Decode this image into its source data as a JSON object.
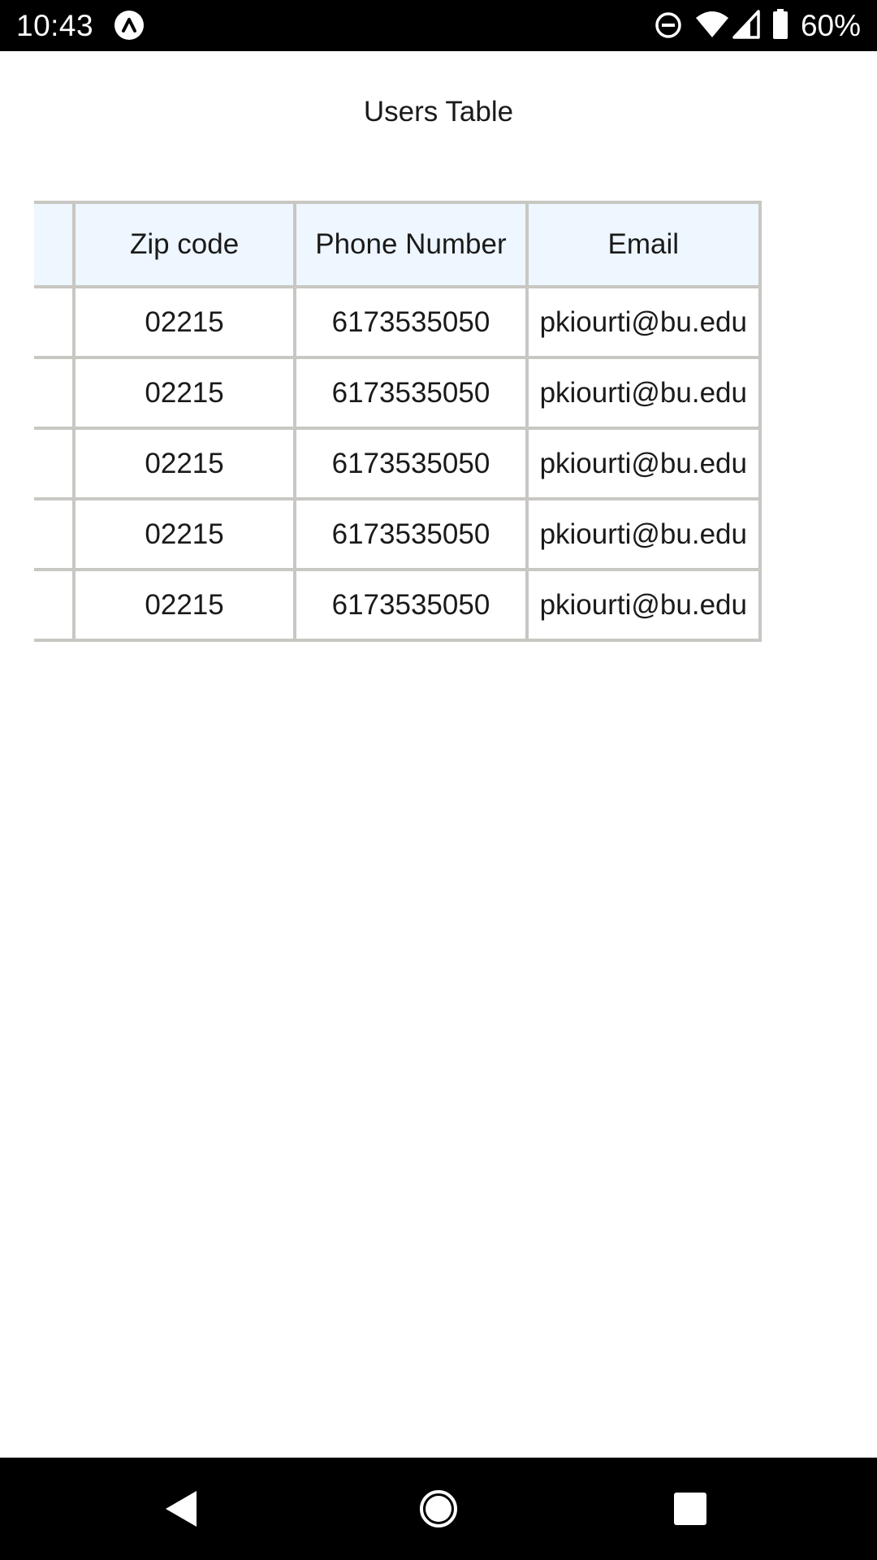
{
  "status_bar": {
    "time": "10:43",
    "battery_percent": "60%",
    "icons": [
      "app-notification-icon",
      "do-not-disturb-icon",
      "wifi-icon",
      "cell-signal-icon",
      "battery-icon"
    ]
  },
  "page": {
    "title": "Users Table"
  },
  "table": {
    "columns": [
      "",
      "Zip code",
      "Phone Number",
      "Email"
    ],
    "rows": [
      {
        "prev": "",
        "zip": "02215",
        "phone": "6173535050",
        "email": "pkiourti@bu.edu"
      },
      {
        "prev": "",
        "zip": "02215",
        "phone": "6173535050",
        "email": "pkiourti@bu.edu"
      },
      {
        "prev": "",
        "zip": "02215",
        "phone": "6173535050",
        "email": "pkiourti@bu.edu"
      },
      {
        "prev": "",
        "zip": "02215",
        "phone": "6173535050",
        "email": "pkiourti@bu.edu"
      },
      {
        "prev": "",
        "zip": "02215",
        "phone": "6173535050",
        "email": "pkiourti@bu.edu"
      }
    ],
    "colors": {
      "header_bg": "#eef6ff",
      "border": "#c8c7c2"
    }
  },
  "nav_bar": {
    "buttons": [
      "back-icon",
      "home-icon",
      "recents-icon"
    ]
  }
}
